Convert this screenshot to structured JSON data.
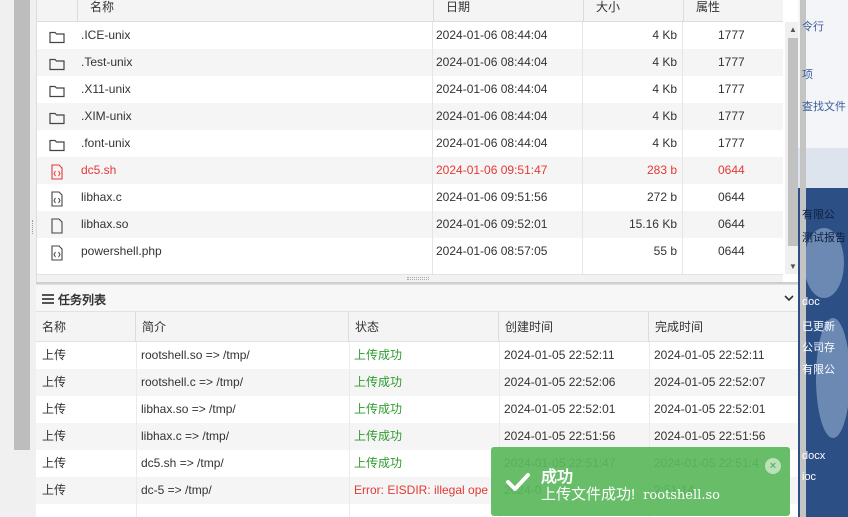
{
  "file_table": {
    "headers": [
      "名称",
      "日期",
      "大小",
      "属性"
    ],
    "rows": [
      {
        "name": ".ICE-unix",
        "date": "2024-01-06 08:44:04",
        "size": "4 Kb",
        "perm": "1777",
        "icon": "folder-icon",
        "highlight": false
      },
      {
        "name": ".Test-unix",
        "date": "2024-01-06 08:44:04",
        "size": "4 Kb",
        "perm": "1777",
        "icon": "folder-icon",
        "highlight": false
      },
      {
        "name": ".X11-unix",
        "date": "2024-01-06 08:44:04",
        "size": "4 Kb",
        "perm": "1777",
        "icon": "folder-icon",
        "highlight": false
      },
      {
        "name": ".XIM-unix",
        "date": "2024-01-06 08:44:04",
        "size": "4 Kb",
        "perm": "1777",
        "icon": "folder-icon",
        "highlight": false
      },
      {
        "name": ".font-unix",
        "date": "2024-01-06 08:44:04",
        "size": "4 Kb",
        "perm": "1777",
        "icon": "folder-icon",
        "highlight": false
      },
      {
        "name": "dc5.sh",
        "date": "2024-01-06 09:51:47",
        "size": "283 b",
        "perm": "0644",
        "icon": "code-file-icon",
        "highlight": true
      },
      {
        "name": "libhax.c",
        "date": "2024-01-06 09:51:56",
        "size": "272 b",
        "perm": "0644",
        "icon": "code-file-icon",
        "highlight": false
      },
      {
        "name": "libhax.so",
        "date": "2024-01-06 09:52:01",
        "size": "15.16 Kb",
        "perm": "0644",
        "icon": "file-icon",
        "highlight": false
      },
      {
        "name": "powershell.php",
        "date": "2024-01-06 08:57:05",
        "size": "55 b",
        "perm": "0644",
        "icon": "code-file-icon",
        "highlight": false
      }
    ]
  },
  "task_panel": {
    "title": "任务列表",
    "headers": [
      "名称",
      "简介",
      "状态",
      "创建时间",
      "完成时间"
    ],
    "rows": [
      {
        "type": "上传",
        "desc": "rootshell.so => /tmp/",
        "status": "上传成功",
        "created": "2024-01-05 22:52:11",
        "finished": "2024-01-05 22:52:11",
        "error": false
      },
      {
        "type": "上传",
        "desc": "rootshell.c => /tmp/",
        "status": "上传成功",
        "created": "2024-01-05 22:52:06",
        "finished": "2024-01-05 22:52:07",
        "error": false
      },
      {
        "type": "上传",
        "desc": "libhax.so => /tmp/",
        "status": "上传成功",
        "created": "2024-01-05 22:52:01",
        "finished": "2024-01-05 22:52:01",
        "error": false
      },
      {
        "type": "上传",
        "desc": "libhax.c => /tmp/",
        "status": "上传成功",
        "created": "2024-01-05 22:51:56",
        "finished": "2024-01-05 22:51:56",
        "error": false
      },
      {
        "type": "上传",
        "desc": "dc5.sh => /tmp/",
        "status": "上传成功",
        "created": "2024-01-05 22:51:47",
        "finished": "2024-01-05 22:51:4",
        "error": false
      },
      {
        "type": "上传",
        "desc": "dc-5 => /tmp/",
        "status": "Error: EISDIR: illegal ope",
        "created": "2024-0",
        "finished": "2:51:14",
        "error": true
      }
    ]
  },
  "toast": {
    "title": "成功",
    "message": "上传文件成功!",
    "filename": "rootshell.so",
    "close_glyph": "×"
  },
  "right_panel": {
    "items": [
      "令行",
      "项",
      "查找文件",
      "有限公",
      "测试报告",
      "doc",
      "已更新",
      "公司存",
      "有限公",
      "docx",
      "ioc"
    ]
  },
  "colors": {
    "highlight_red": "#e53935",
    "success_green": "#2e9b2e",
    "toast_bg": "#5cb85c"
  }
}
